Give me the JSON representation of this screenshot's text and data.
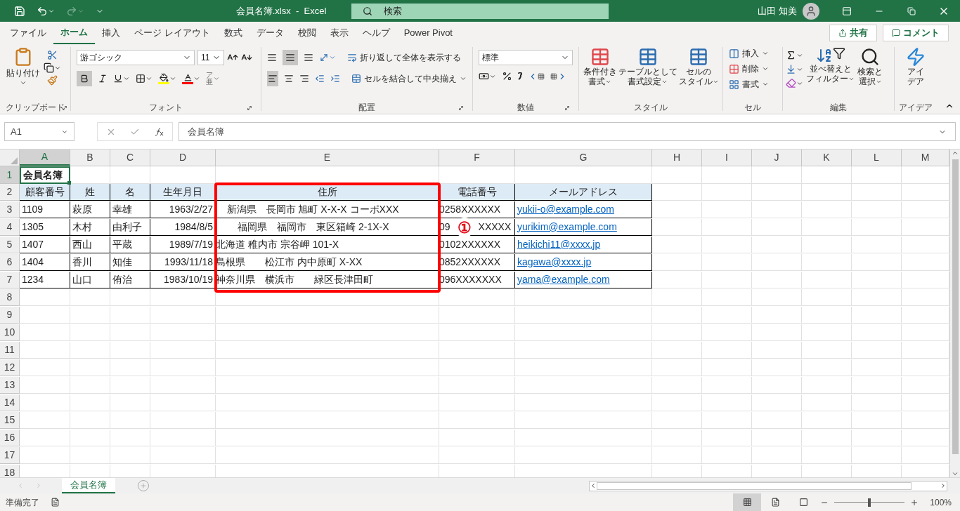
{
  "title_bar": {
    "file_title": "会員名簿.xlsx  -  Excel",
    "search_placeholder": "検索",
    "user": "山田 知美"
  },
  "menu_tabs": [
    {
      "label": "ファイル",
      "selected": false
    },
    {
      "label": "ホーム",
      "selected": true
    },
    {
      "label": "挿入",
      "selected": false
    },
    {
      "label": "ページ レイアウト",
      "selected": false
    },
    {
      "label": "数式",
      "selected": false
    },
    {
      "label": "データ",
      "selected": false
    },
    {
      "label": "校閲",
      "selected": false
    },
    {
      "label": "表示",
      "selected": false
    },
    {
      "label": "ヘルプ",
      "selected": false
    },
    {
      "label": "Power Pivot",
      "selected": false
    }
  ],
  "share_button": "共有",
  "comment_button": "コメント",
  "ribbon": {
    "clipboard": {
      "paste": "貼り付け",
      "label": "クリップボード"
    },
    "font": {
      "name": "游ゴシック",
      "size": "11",
      "phonetic": [
        "ア",
        "亜"
      ],
      "label": "フォント"
    },
    "alignment": {
      "wrap": "折り返して全体を表示する",
      "merge": "セルを結合して中央揃え",
      "label": "配置"
    },
    "number": {
      "format": "標準",
      "label": "数値"
    },
    "styles": {
      "buttons": [
        [
          "条件付き",
          "書式"
        ],
        [
          "テーブルとして",
          "書式設定"
        ],
        [
          "セルの",
          "スタイル"
        ]
      ],
      "label": "スタイル"
    },
    "cells": {
      "items": [
        "挿入",
        "削除",
        "書式"
      ],
      "label": "セル"
    },
    "editing": {
      "buttons": [
        [
          "並べ替えと",
          "フィルター"
        ],
        [
          "検索と",
          "選択"
        ]
      ],
      "label": "編集"
    },
    "ideas": {
      "button": [
        "アイ",
        "デア"
      ],
      "label": "アイデア"
    }
  },
  "formula_bar": {
    "name_box": "A1",
    "formula": "会員名簿"
  },
  "columns": [
    {
      "label": "A",
      "selected": true
    },
    {
      "label": "B",
      "selected": false
    },
    {
      "label": "C",
      "selected": false
    },
    {
      "label": "D",
      "selected": false
    },
    {
      "label": "E",
      "selected": false
    },
    {
      "label": "F",
      "selected": false
    },
    {
      "label": "G",
      "selected": false
    },
    {
      "label": "H",
      "selected": false
    },
    {
      "label": "I",
      "selected": false
    },
    {
      "label": "J",
      "selected": false
    },
    {
      "label": "K",
      "selected": false
    },
    {
      "label": "L",
      "selected": false
    },
    {
      "label": "M",
      "selected": false
    }
  ],
  "sheet": {
    "title_cell": "会員名簿",
    "headers": [
      "顧客番号",
      "姓",
      "名",
      "生年月日",
      "住所",
      "電話番号",
      "メールアドレス"
    ],
    "rows": [
      {
        "id": "1109",
        "last": "萩原",
        "first": "幸雄",
        "birth": "1963/2/27",
        "address": "    新潟県　長岡市 旭町 X-X-X コーポXXX",
        "phone": "0258XXXXXX",
        "email": "yukii-o@example.com"
      },
      {
        "id": "1305",
        "last": "木村",
        "first": "由利子",
        "birth": "1984/8/5",
        "address": "        福岡県　福岡市　東区箱崎 2-1X-X",
        "phone": "09",
        "phone_after": "XXXXX",
        "marker": "①",
        "email": "yurikim@example.com"
      },
      {
        "id": "1407",
        "last": "西山",
        "first": "平蔵",
        "birth": "1989/7/19",
        "address": "北海道 稚内市 宗谷岬 101-X",
        "phone": "0102XXXXXX",
        "email": "heikichi11@xxxx.jp"
      },
      {
        "id": "1404",
        "last": "香川",
        "first": "知佳",
        "birth": "1993/11/18",
        "address": "島根県　　松江市 内中原町 X-XX",
        "phone": "0852XXXXXX",
        "email": "kagawa@xxxx.jp"
      },
      {
        "id": "1234",
        "last": "山口",
        "first": "侑治",
        "birth": "1983/10/19",
        "address": "神奈川県　横浜市　　緑区長津田町",
        "phone": "096XXXXXXX",
        "email": "yama@example.com"
      }
    ]
  },
  "row_numbers": [
    {
      "label": "1",
      "selected": true
    },
    {
      "label": "2",
      "selected": false
    },
    {
      "label": "3",
      "selected": false
    },
    {
      "label": "4",
      "selected": false
    },
    {
      "label": "5",
      "selected": false
    },
    {
      "label": "6",
      "selected": false
    },
    {
      "label": "7",
      "selected": false
    },
    {
      "label": "8",
      "selected": false
    },
    {
      "label": "9",
      "selected": false
    },
    {
      "label": "10",
      "selected": false
    },
    {
      "label": "11",
      "selected": false
    },
    {
      "label": "12",
      "selected": false
    },
    {
      "label": "13",
      "selected": false
    },
    {
      "label": "14",
      "selected": false
    },
    {
      "label": "15",
      "selected": false
    },
    {
      "label": "16",
      "selected": false
    },
    {
      "label": "17",
      "selected": false
    },
    {
      "label": "18",
      "selected": false
    }
  ],
  "sheet_tabs": [
    {
      "label": "会員名簿",
      "selected": true
    }
  ],
  "status_bar": {
    "status": "準備完了",
    "zoom": "100%",
    "level": 0.5
  }
}
